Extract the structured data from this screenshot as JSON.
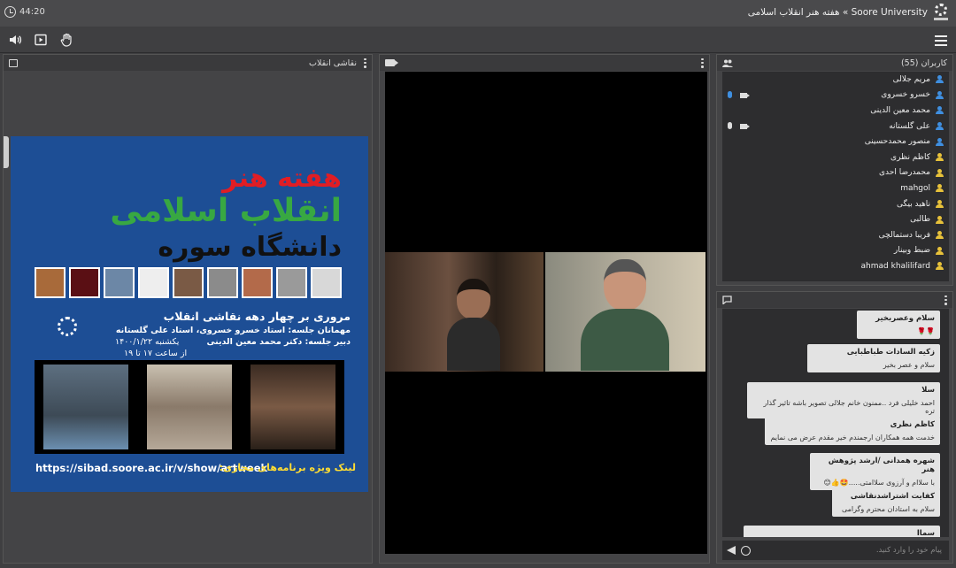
{
  "header": {
    "timer": "44:20",
    "breadcrumb": "Soore University » هفته هنر انقلاب اسلامی"
  },
  "toolbar": {
    "icons": [
      "speaker-icon",
      "play-window-icon",
      "raise-hand-icon",
      "menu-icon"
    ]
  },
  "left_panel": {
    "title": "نقاشی انقلاب",
    "poster": {
      "title_line1": "هفته هنر",
      "title_line2": "انقلاب اسلامی",
      "title_line3": "دانشگاه سوره",
      "headline": "مروری بر چهار دهه نقاشی انقلاب",
      "guests": "مهمانان جلسه: استاد خسرو خسروی، استاد علی گلستانه",
      "host": "دبیر جلسه: دکتر محمد معین الدینی",
      "date": "یکشنبه ۱۴۰۰/۱/۲۲",
      "time": "از ساعت ۱۷ تا ۱۹",
      "link_label": "لینک ویژه برنامه‌های مجازی:",
      "link": "https://sibad.soore.ac.ir/v/show/artweek"
    }
  },
  "users_panel": {
    "title": "کاربران (55)",
    "users": [
      {
        "name": "مریم جلالی",
        "color": "#3f8fe0",
        "mic": false,
        "cam": false
      },
      {
        "name": "خسرو خسروی",
        "color": "#3f8fe0",
        "mic": true,
        "cam": true,
        "mic_color": "#3f8fe0"
      },
      {
        "name": "محمد معین الدینی",
        "color": "#3f8fe0",
        "mic": false,
        "cam": false
      },
      {
        "name": "علی گلستانه",
        "color": "#3f8fe0",
        "mic": true,
        "cam": true,
        "mic_color": "#dddddd"
      },
      {
        "name": "منصور محمدحسینی",
        "color": "#3f8fe0",
        "mic": false,
        "cam": false
      },
      {
        "name": "کاظم نظری",
        "color": "#e8c23a",
        "mic": false,
        "cam": false
      },
      {
        "name": "محمدرضا احدی",
        "color": "#e8c23a",
        "mic": false,
        "cam": false
      },
      {
        "name": "mahgol",
        "color": "#e8c23a",
        "mic": false,
        "cam": false
      },
      {
        "name": "ناهید بیگی",
        "color": "#e8c23a",
        "mic": false,
        "cam": false
      },
      {
        "name": "طالبی",
        "color": "#e8c23a",
        "mic": false,
        "cam": false
      },
      {
        "name": "فریبا دستمالچی",
        "color": "#e8c23a",
        "mic": false,
        "cam": false
      },
      {
        "name": "ضبط وبینار",
        "color": "#e8c23a",
        "mic": false,
        "cam": false
      },
      {
        "name": "ahmad khalilifard",
        "color": "#e8c23a",
        "mic": false,
        "cam": false
      }
    ]
  },
  "chat_panel": {
    "placeholder": "پیام خود را وارد کنید.",
    "messages": [
      {
        "sender": "سلام وعصربخیر",
        "body": "🌹🌹"
      },
      {
        "sender": "زکیه السادات طباطبایی",
        "body": "سلام و عصر بخیر"
      },
      {
        "sender": "سلا",
        "body": "احمد خلیلی فرد ..ممنون خانم جلالی تصویر باشه تاثیر گذار تره"
      },
      {
        "sender": "کاظم نظری",
        "body": "خدمت همه همکاران ارجمندم خیر مقدم عرض می نمایم"
      },
      {
        "sender": "شهره همدانی /ارشد پژوهش هنر",
        "body": "با سلاام و آرزوی سلاامتی.....🤩👍😊"
      },
      {
        "sender": "کفایت اشتراشدنقاشی",
        "body": "سلام  به استادان محترم وگرامی"
      },
      {
        "sender": "سماا",
        "body": ""
      }
    ]
  }
}
